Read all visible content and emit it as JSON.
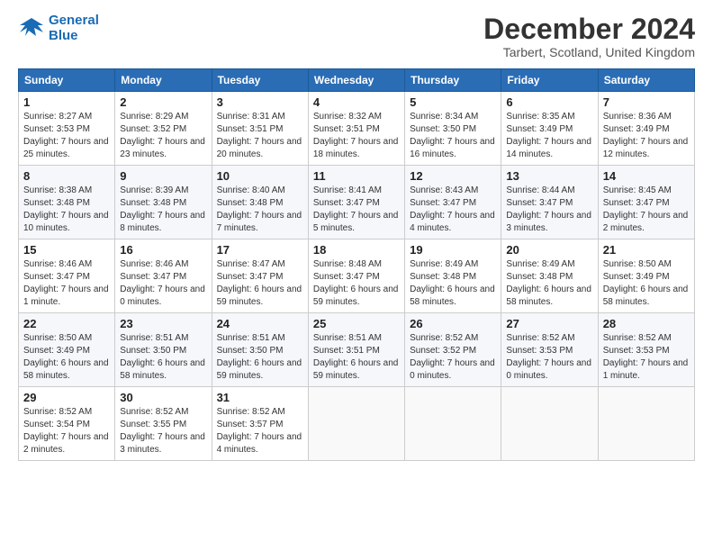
{
  "header": {
    "logo_line1": "General",
    "logo_line2": "Blue",
    "month": "December 2024",
    "location": "Tarbert, Scotland, United Kingdom"
  },
  "weekdays": [
    "Sunday",
    "Monday",
    "Tuesday",
    "Wednesday",
    "Thursday",
    "Friday",
    "Saturday"
  ],
  "weeks": [
    [
      {
        "day": "1",
        "sunrise": "8:27 AM",
        "sunset": "3:53 PM",
        "daylight": "7 hours and 25 minutes."
      },
      {
        "day": "2",
        "sunrise": "8:29 AM",
        "sunset": "3:52 PM",
        "daylight": "7 hours and 23 minutes."
      },
      {
        "day": "3",
        "sunrise": "8:31 AM",
        "sunset": "3:51 PM",
        "daylight": "7 hours and 20 minutes."
      },
      {
        "day": "4",
        "sunrise": "8:32 AM",
        "sunset": "3:51 PM",
        "daylight": "7 hours and 18 minutes."
      },
      {
        "day": "5",
        "sunrise": "8:34 AM",
        "sunset": "3:50 PM",
        "daylight": "7 hours and 16 minutes."
      },
      {
        "day": "6",
        "sunrise": "8:35 AM",
        "sunset": "3:49 PM",
        "daylight": "7 hours and 14 minutes."
      },
      {
        "day": "7",
        "sunrise": "8:36 AM",
        "sunset": "3:49 PM",
        "daylight": "7 hours and 12 minutes."
      }
    ],
    [
      {
        "day": "8",
        "sunrise": "8:38 AM",
        "sunset": "3:48 PM",
        "daylight": "7 hours and 10 minutes."
      },
      {
        "day": "9",
        "sunrise": "8:39 AM",
        "sunset": "3:48 PM",
        "daylight": "7 hours and 8 minutes."
      },
      {
        "day": "10",
        "sunrise": "8:40 AM",
        "sunset": "3:48 PM",
        "daylight": "7 hours and 7 minutes."
      },
      {
        "day": "11",
        "sunrise": "8:41 AM",
        "sunset": "3:47 PM",
        "daylight": "7 hours and 5 minutes."
      },
      {
        "day": "12",
        "sunrise": "8:43 AM",
        "sunset": "3:47 PM",
        "daylight": "7 hours and 4 minutes."
      },
      {
        "day": "13",
        "sunrise": "8:44 AM",
        "sunset": "3:47 PM",
        "daylight": "7 hours and 3 minutes."
      },
      {
        "day": "14",
        "sunrise": "8:45 AM",
        "sunset": "3:47 PM",
        "daylight": "7 hours and 2 minutes."
      }
    ],
    [
      {
        "day": "15",
        "sunrise": "8:46 AM",
        "sunset": "3:47 PM",
        "daylight": "7 hours and 1 minute."
      },
      {
        "day": "16",
        "sunrise": "8:46 AM",
        "sunset": "3:47 PM",
        "daylight": "7 hours and 0 minutes."
      },
      {
        "day": "17",
        "sunrise": "8:47 AM",
        "sunset": "3:47 PM",
        "daylight": "6 hours and 59 minutes."
      },
      {
        "day": "18",
        "sunrise": "8:48 AM",
        "sunset": "3:47 PM",
        "daylight": "6 hours and 59 minutes."
      },
      {
        "day": "19",
        "sunrise": "8:49 AM",
        "sunset": "3:48 PM",
        "daylight": "6 hours and 58 minutes."
      },
      {
        "day": "20",
        "sunrise": "8:49 AM",
        "sunset": "3:48 PM",
        "daylight": "6 hours and 58 minutes."
      },
      {
        "day": "21",
        "sunrise": "8:50 AM",
        "sunset": "3:49 PM",
        "daylight": "6 hours and 58 minutes."
      }
    ],
    [
      {
        "day": "22",
        "sunrise": "8:50 AM",
        "sunset": "3:49 PM",
        "daylight": "6 hours and 58 minutes."
      },
      {
        "day": "23",
        "sunrise": "8:51 AM",
        "sunset": "3:50 PM",
        "daylight": "6 hours and 58 minutes."
      },
      {
        "day": "24",
        "sunrise": "8:51 AM",
        "sunset": "3:50 PM",
        "daylight": "6 hours and 59 minutes."
      },
      {
        "day": "25",
        "sunrise": "8:51 AM",
        "sunset": "3:51 PM",
        "daylight": "6 hours and 59 minutes."
      },
      {
        "day": "26",
        "sunrise": "8:52 AM",
        "sunset": "3:52 PM",
        "daylight": "7 hours and 0 minutes."
      },
      {
        "day": "27",
        "sunrise": "8:52 AM",
        "sunset": "3:53 PM",
        "daylight": "7 hours and 0 minutes."
      },
      {
        "day": "28",
        "sunrise": "8:52 AM",
        "sunset": "3:53 PM",
        "daylight": "7 hours and 1 minute."
      }
    ],
    [
      {
        "day": "29",
        "sunrise": "8:52 AM",
        "sunset": "3:54 PM",
        "daylight": "7 hours and 2 minutes."
      },
      {
        "day": "30",
        "sunrise": "8:52 AM",
        "sunset": "3:55 PM",
        "daylight": "7 hours and 3 minutes."
      },
      {
        "day": "31",
        "sunrise": "8:52 AM",
        "sunset": "3:57 PM",
        "daylight": "7 hours and 4 minutes."
      },
      null,
      null,
      null,
      null
    ]
  ]
}
